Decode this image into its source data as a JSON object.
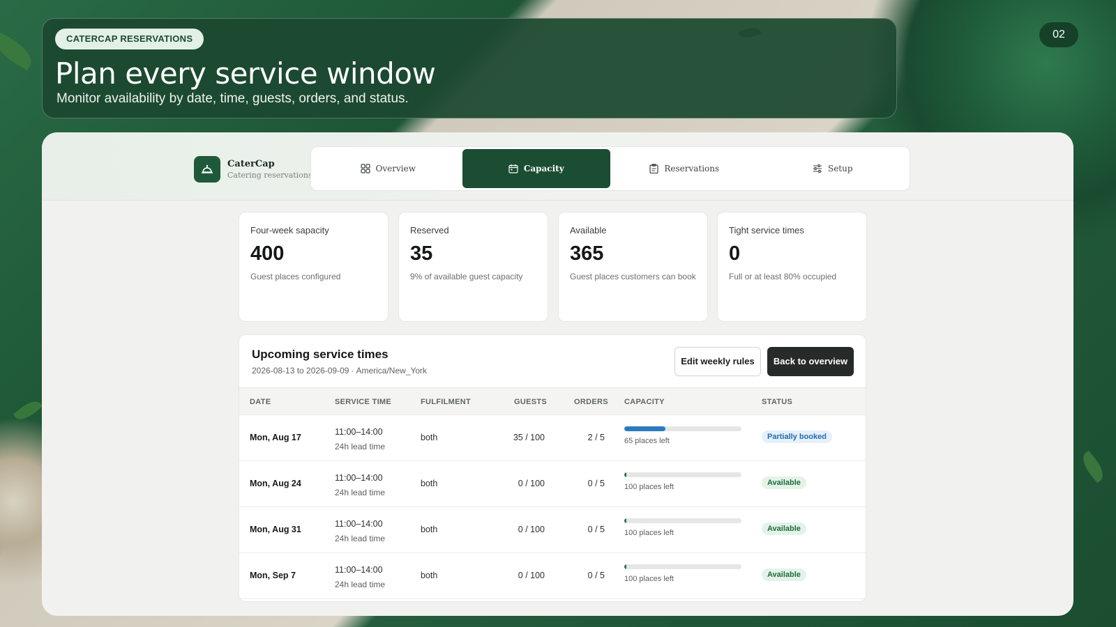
{
  "hero": {
    "badge": "CATERCAP RESERVATIONS",
    "title": "Plan every service window",
    "subtitle": "Monitor availability by date, time, guests, orders, and status.",
    "page_number": "02"
  },
  "brand": {
    "name": "CaterCap",
    "tagline": "Catering reservations",
    "logo_icon": "cloche-icon"
  },
  "tabs": [
    {
      "label": "Overview",
      "icon": "grid-icon",
      "active": false
    },
    {
      "label": "Capacity",
      "icon": "calendar-icon",
      "active": true
    },
    {
      "label": "Reservations",
      "icon": "clipboard-icon",
      "active": false
    },
    {
      "label": "Setup",
      "icon": "sliders-icon",
      "active": false
    }
  ],
  "stats": [
    {
      "label": "Four-week sapacity",
      "value": "400",
      "desc": "Guest places configured"
    },
    {
      "label": "Reserved",
      "value": "35",
      "desc": "9% of available guest capacity"
    },
    {
      "label": "Available",
      "value": "365",
      "desc": "Guest places customers can book"
    },
    {
      "label": "Tight service times",
      "value": "0",
      "desc": "Full or at least 80% occupied"
    }
  ],
  "service_panel": {
    "title": "Upcoming service times",
    "subtitle": "2026-08-13 to 2026-09-09 · America/New_York",
    "edit_button": "Edit weekly rules",
    "back_button": "Back to overview"
  },
  "table": {
    "headers": {
      "date": "DATE",
      "time": "SERVICE TIME",
      "fulfilment": "FULFILMENT",
      "guests": "GUESTS",
      "orders": "ORDERS",
      "capacity": "CAPACITY",
      "status": "STATUS"
    },
    "rows": [
      {
        "date": "Mon, Aug 17",
        "time": "11:00–14:00",
        "lead": "24h lead time",
        "fulfilment": "both",
        "guests": "35 / 100",
        "orders": "2 / 5",
        "fill_fraction": 0.35,
        "places_left": "65 places left",
        "status": "Partially booked"
      },
      {
        "date": "Mon, Aug 24",
        "time": "11:00–14:00",
        "lead": "24h lead time",
        "fulfilment": "both",
        "guests": "0 / 100",
        "orders": "0 / 5",
        "fill_fraction": 0.0,
        "places_left": "100 places left",
        "status": "Available"
      },
      {
        "date": "Mon, Aug 31",
        "time": "11:00–14:00",
        "lead": "24h lead time",
        "fulfilment": "both",
        "guests": "0 / 100",
        "orders": "0 / 5",
        "fill_fraction": 0.0,
        "places_left": "100 places left",
        "status": "Available"
      },
      {
        "date": "Mon, Sep 7",
        "time": "11:00–14:00",
        "lead": "24h lead time",
        "fulfilment": "both",
        "guests": "0 / 100",
        "orders": "0 / 5",
        "fill_fraction": 0.0,
        "places_left": "100 places left",
        "status": "Available"
      }
    ]
  },
  "colors": {
    "brand_green": "#1b4d33",
    "partial_fill": "#2b7bbf",
    "partial_pill_bg": "#e6f0fa",
    "partial_pill_text": "#1f6cb0",
    "available_fill": "#1f7a45",
    "available_pill_bg": "#e3f3e8",
    "available_pill_text": "#1e6b3d"
  }
}
